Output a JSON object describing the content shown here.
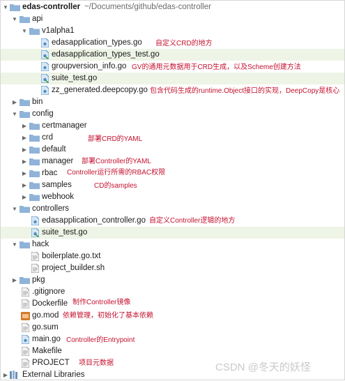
{
  "project": {
    "name": "edas-controller",
    "path": "~/Documents/github/edas-controller"
  },
  "tree": {
    "api": "api",
    "v1alpha1": "v1alpha1",
    "edas_types": "edasapplication_types.go",
    "edas_types_test": "edasapplication_types_test.go",
    "groupversion_info": "groupversion_info.go",
    "api_suite_test": "suite_test.go",
    "zz_generated": "zz_generated.deepcopy.go",
    "bin": "bin",
    "config": "config",
    "certmanager": "certmanager",
    "crd": "crd",
    "default": "default",
    "manager": "manager",
    "rbac": "rbac",
    "samples": "samples",
    "webhook": "webhook",
    "controllers": "controllers",
    "edas_controller": "edasapplication_controller.go",
    "controllers_suite_test": "suite_test.go",
    "hack": "hack",
    "boilerplate": "boilerplate.go.txt",
    "project_builder": "project_builder.sh",
    "pkg": "pkg",
    "gitignore": ".gitignore",
    "dockerfile": "Dockerfile",
    "gomod": "go.mod",
    "gosum": "go.sum",
    "maingo": "main.go",
    "makefile": "Makefile",
    "project_file": "PROJECT",
    "external_libraries": "External Libraries"
  },
  "annotations": {
    "types": "自定义CRD的地方",
    "groupversion": "GV的通用元数据用于CRD生成，以及Scheme创建方法",
    "zz_generated": "包含代码生成的runtime.Object接口的实现，DeepCopy是核心",
    "crd": "部署CRD的YAML",
    "manager": "部署Controller的YAML",
    "rbac": "Controller运行所需的RBAC权限",
    "samples": "CD的samples",
    "controller": "自定义Controller逻辑的地方",
    "dockerfile": "制作Controller镜像",
    "gomod": "依赖管理，初始化了基本依赖",
    "maingo": "Controller的Entrypoint",
    "project": "项目元数据"
  },
  "watermark": "CSDN @冬天的妖怪",
  "colors": {
    "folder": "#8fb3d9",
    "go_file": "#4a90c8",
    "annotation": "#c4122f",
    "highlight_row": "#eef4e6"
  }
}
